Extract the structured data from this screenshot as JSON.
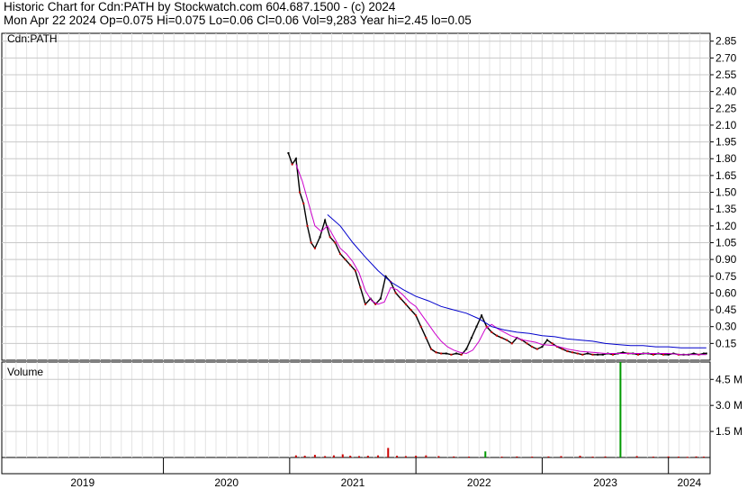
{
  "header": {
    "line1": "Historic Chart for Cdn:PATH by Stockwatch.com 604.687.1500 - (c) 2024",
    "line2": "Mon Apr 22 2024  Op=0.075  Hi=0.075  Lo=0.06  Cl=0.06  Vol=9,283  Year hi=2.45  lo=0.05"
  },
  "colors": {
    "price": "#000000",
    "down_day": "#cc0000",
    "ma_short": "#cc00cc",
    "ma_long": "#0000cc",
    "volume": "#cc0000",
    "volume_spike": "#009900",
    "grid": "#c8c8c8"
  },
  "chart_data": [
    {
      "type": "line",
      "panel_label": "Cdn:PATH",
      "y_ticks": [
        "2.85",
        "2.70",
        "2.55",
        "2.40",
        "2.25",
        "2.10",
        "1.95",
        "1.80",
        "1.65",
        "1.50",
        "1.35",
        "1.20",
        "1.05",
        "0.90",
        "0.75",
        "0.60",
        "0.45",
        "0.30",
        "0.15"
      ],
      "ylim": [
        0.0,
        2.92
      ],
      "x_labels": [
        "2019",
        "2020",
        "2021",
        "2022",
        "2023",
        "2024"
      ],
      "series": [
        {
          "kind": "price",
          "x": [
            2020.99,
            2021.02,
            2021.05,
            2021.08,
            2021.11,
            2021.14,
            2021.17,
            2021.2,
            2021.24,
            2021.28,
            2021.32,
            2021.36,
            2021.4,
            2021.44,
            2021.48,
            2021.52,
            2021.56,
            2021.6,
            2021.64,
            2021.68,
            2021.72,
            2021.76,
            2021.8,
            2021.84,
            2021.88,
            2021.92,
            2021.96,
            2022.0,
            2022.04,
            2022.08,
            2022.12,
            2022.16,
            2022.2,
            2022.24,
            2022.28,
            2022.32,
            2022.36,
            2022.4,
            2022.44,
            2022.48,
            2022.52,
            2022.56,
            2022.6,
            2022.64,
            2022.68,
            2022.72,
            2022.76,
            2022.8,
            2022.84,
            2022.88,
            2022.92,
            2022.96,
            2023.0,
            2023.04,
            2023.08,
            2023.12,
            2023.16,
            2023.2,
            2023.24,
            2023.28,
            2023.32,
            2023.36,
            2023.4,
            2023.44,
            2023.48,
            2023.52,
            2023.56,
            2023.6,
            2023.64,
            2023.68,
            2023.72,
            2023.76,
            2023.8,
            2023.84,
            2023.88,
            2023.92,
            2023.96,
            2024.0,
            2024.04,
            2024.08,
            2024.12,
            2024.16,
            2024.2,
            2024.24,
            2024.28,
            2024.3
          ],
          "y": [
            1.85,
            1.75,
            1.8,
            1.5,
            1.4,
            1.2,
            1.05,
            1.0,
            1.1,
            1.25,
            1.1,
            1.05,
            0.95,
            0.9,
            0.85,
            0.8,
            0.65,
            0.5,
            0.55,
            0.5,
            0.55,
            0.75,
            0.7,
            0.6,
            0.55,
            0.5,
            0.45,
            0.4,
            0.3,
            0.2,
            0.1,
            0.07,
            0.06,
            0.06,
            0.05,
            0.06,
            0.05,
            0.1,
            0.2,
            0.3,
            0.4,
            0.3,
            0.25,
            0.22,
            0.2,
            0.18,
            0.15,
            0.2,
            0.18,
            0.15,
            0.12,
            0.1,
            0.12,
            0.18,
            0.15,
            0.12,
            0.1,
            0.08,
            0.07,
            0.06,
            0.05,
            0.06,
            0.05,
            0.05,
            0.05,
            0.06,
            0.05,
            0.06,
            0.07,
            0.06,
            0.06,
            0.05,
            0.06,
            0.06,
            0.05,
            0.06,
            0.05,
            0.05,
            0.06,
            0.05,
            0.05,
            0.05,
            0.06,
            0.05,
            0.06,
            0.06
          ]
        },
        {
          "kind": "moving_average_short",
          "x": [
            2021.05,
            2021.1,
            2021.15,
            2021.2,
            2021.25,
            2021.3,
            2021.35,
            2021.4,
            2021.45,
            2021.5,
            2021.55,
            2021.6,
            2021.65,
            2021.7,
            2021.75,
            2021.8,
            2021.85,
            2021.9,
            2021.95,
            2022.0,
            2022.05,
            2022.1,
            2022.15,
            2022.2,
            2022.25,
            2022.3,
            2022.35,
            2022.4,
            2022.45,
            2022.5,
            2022.55,
            2022.6,
            2022.65,
            2022.7,
            2022.75,
            2022.8,
            2022.85,
            2022.9,
            2022.95,
            2023.0,
            2023.1,
            2023.2,
            2023.3,
            2023.4,
            2023.5,
            2023.6,
            2023.7,
            2023.8,
            2023.9,
            2024.0,
            2024.1,
            2024.2,
            2024.3
          ],
          "y": [
            1.75,
            1.6,
            1.4,
            1.2,
            1.15,
            1.2,
            1.1,
            1.0,
            0.95,
            0.88,
            0.78,
            0.62,
            0.53,
            0.5,
            0.52,
            0.65,
            0.63,
            0.58,
            0.52,
            0.48,
            0.4,
            0.32,
            0.24,
            0.17,
            0.12,
            0.09,
            0.07,
            0.06,
            0.09,
            0.17,
            0.28,
            0.32,
            0.28,
            0.25,
            0.22,
            0.2,
            0.18,
            0.17,
            0.16,
            0.14,
            0.13,
            0.1,
            0.08,
            0.07,
            0.06,
            0.06,
            0.06,
            0.06,
            0.06,
            0.06,
            0.05,
            0.05,
            0.05
          ]
        },
        {
          "kind": "moving_average_long",
          "x": [
            2021.3,
            2021.4,
            2021.5,
            2021.6,
            2021.7,
            2021.8,
            2021.9,
            2022.0,
            2022.1,
            2022.2,
            2022.3,
            2022.4,
            2022.5,
            2022.6,
            2022.7,
            2022.8,
            2022.9,
            2023.0,
            2023.1,
            2023.2,
            2023.3,
            2023.4,
            2023.5,
            2023.6,
            2023.7,
            2023.8,
            2023.9,
            2024.0,
            2024.1,
            2024.2,
            2024.3
          ],
          "y": [
            1.3,
            1.2,
            1.05,
            0.92,
            0.8,
            0.7,
            0.63,
            0.57,
            0.53,
            0.48,
            0.45,
            0.42,
            0.37,
            0.3,
            0.27,
            0.25,
            0.24,
            0.22,
            0.21,
            0.19,
            0.18,
            0.17,
            0.15,
            0.14,
            0.13,
            0.13,
            0.12,
            0.12,
            0.11,
            0.11,
            0.11
          ]
        }
      ]
    },
    {
      "type": "bar",
      "panel_label": "Volume",
      "y_ticks": [
        "4.5 M",
        "3.0 M",
        "1.5 M"
      ],
      "ylim": [
        0,
        5.5
      ],
      "x": [
        2021.05,
        2021.12,
        2021.2,
        2021.28,
        2021.35,
        2021.42,
        2021.48,
        2021.55,
        2021.62,
        2021.7,
        2021.78,
        2021.85,
        2021.92,
        2022.0,
        2022.08,
        2022.18,
        2022.3,
        2022.42,
        2022.55,
        2022.68,
        2022.8,
        2022.92,
        2023.05,
        2023.15,
        2023.3,
        2023.4,
        2023.5,
        2023.62,
        2023.75,
        2023.88,
        2024.0,
        2024.08,
        2024.15,
        2024.22,
        2024.28
      ],
      "values": [
        0.12,
        0.1,
        0.15,
        0.08,
        0.12,
        0.18,
        0.1,
        0.08,
        0.1,
        0.12,
        0.55,
        0.1,
        0.08,
        0.1,
        0.12,
        0.08,
        0.06,
        0.05,
        0.35,
        0.05,
        0.06,
        0.05,
        0.06,
        0.08,
        0.1,
        0.05,
        0.06,
        5.8,
        0.08,
        0.05,
        0.06,
        0.05,
        0.04,
        0.06,
        0.05
      ],
      "highlight_indices": [
        18,
        27
      ]
    }
  ]
}
